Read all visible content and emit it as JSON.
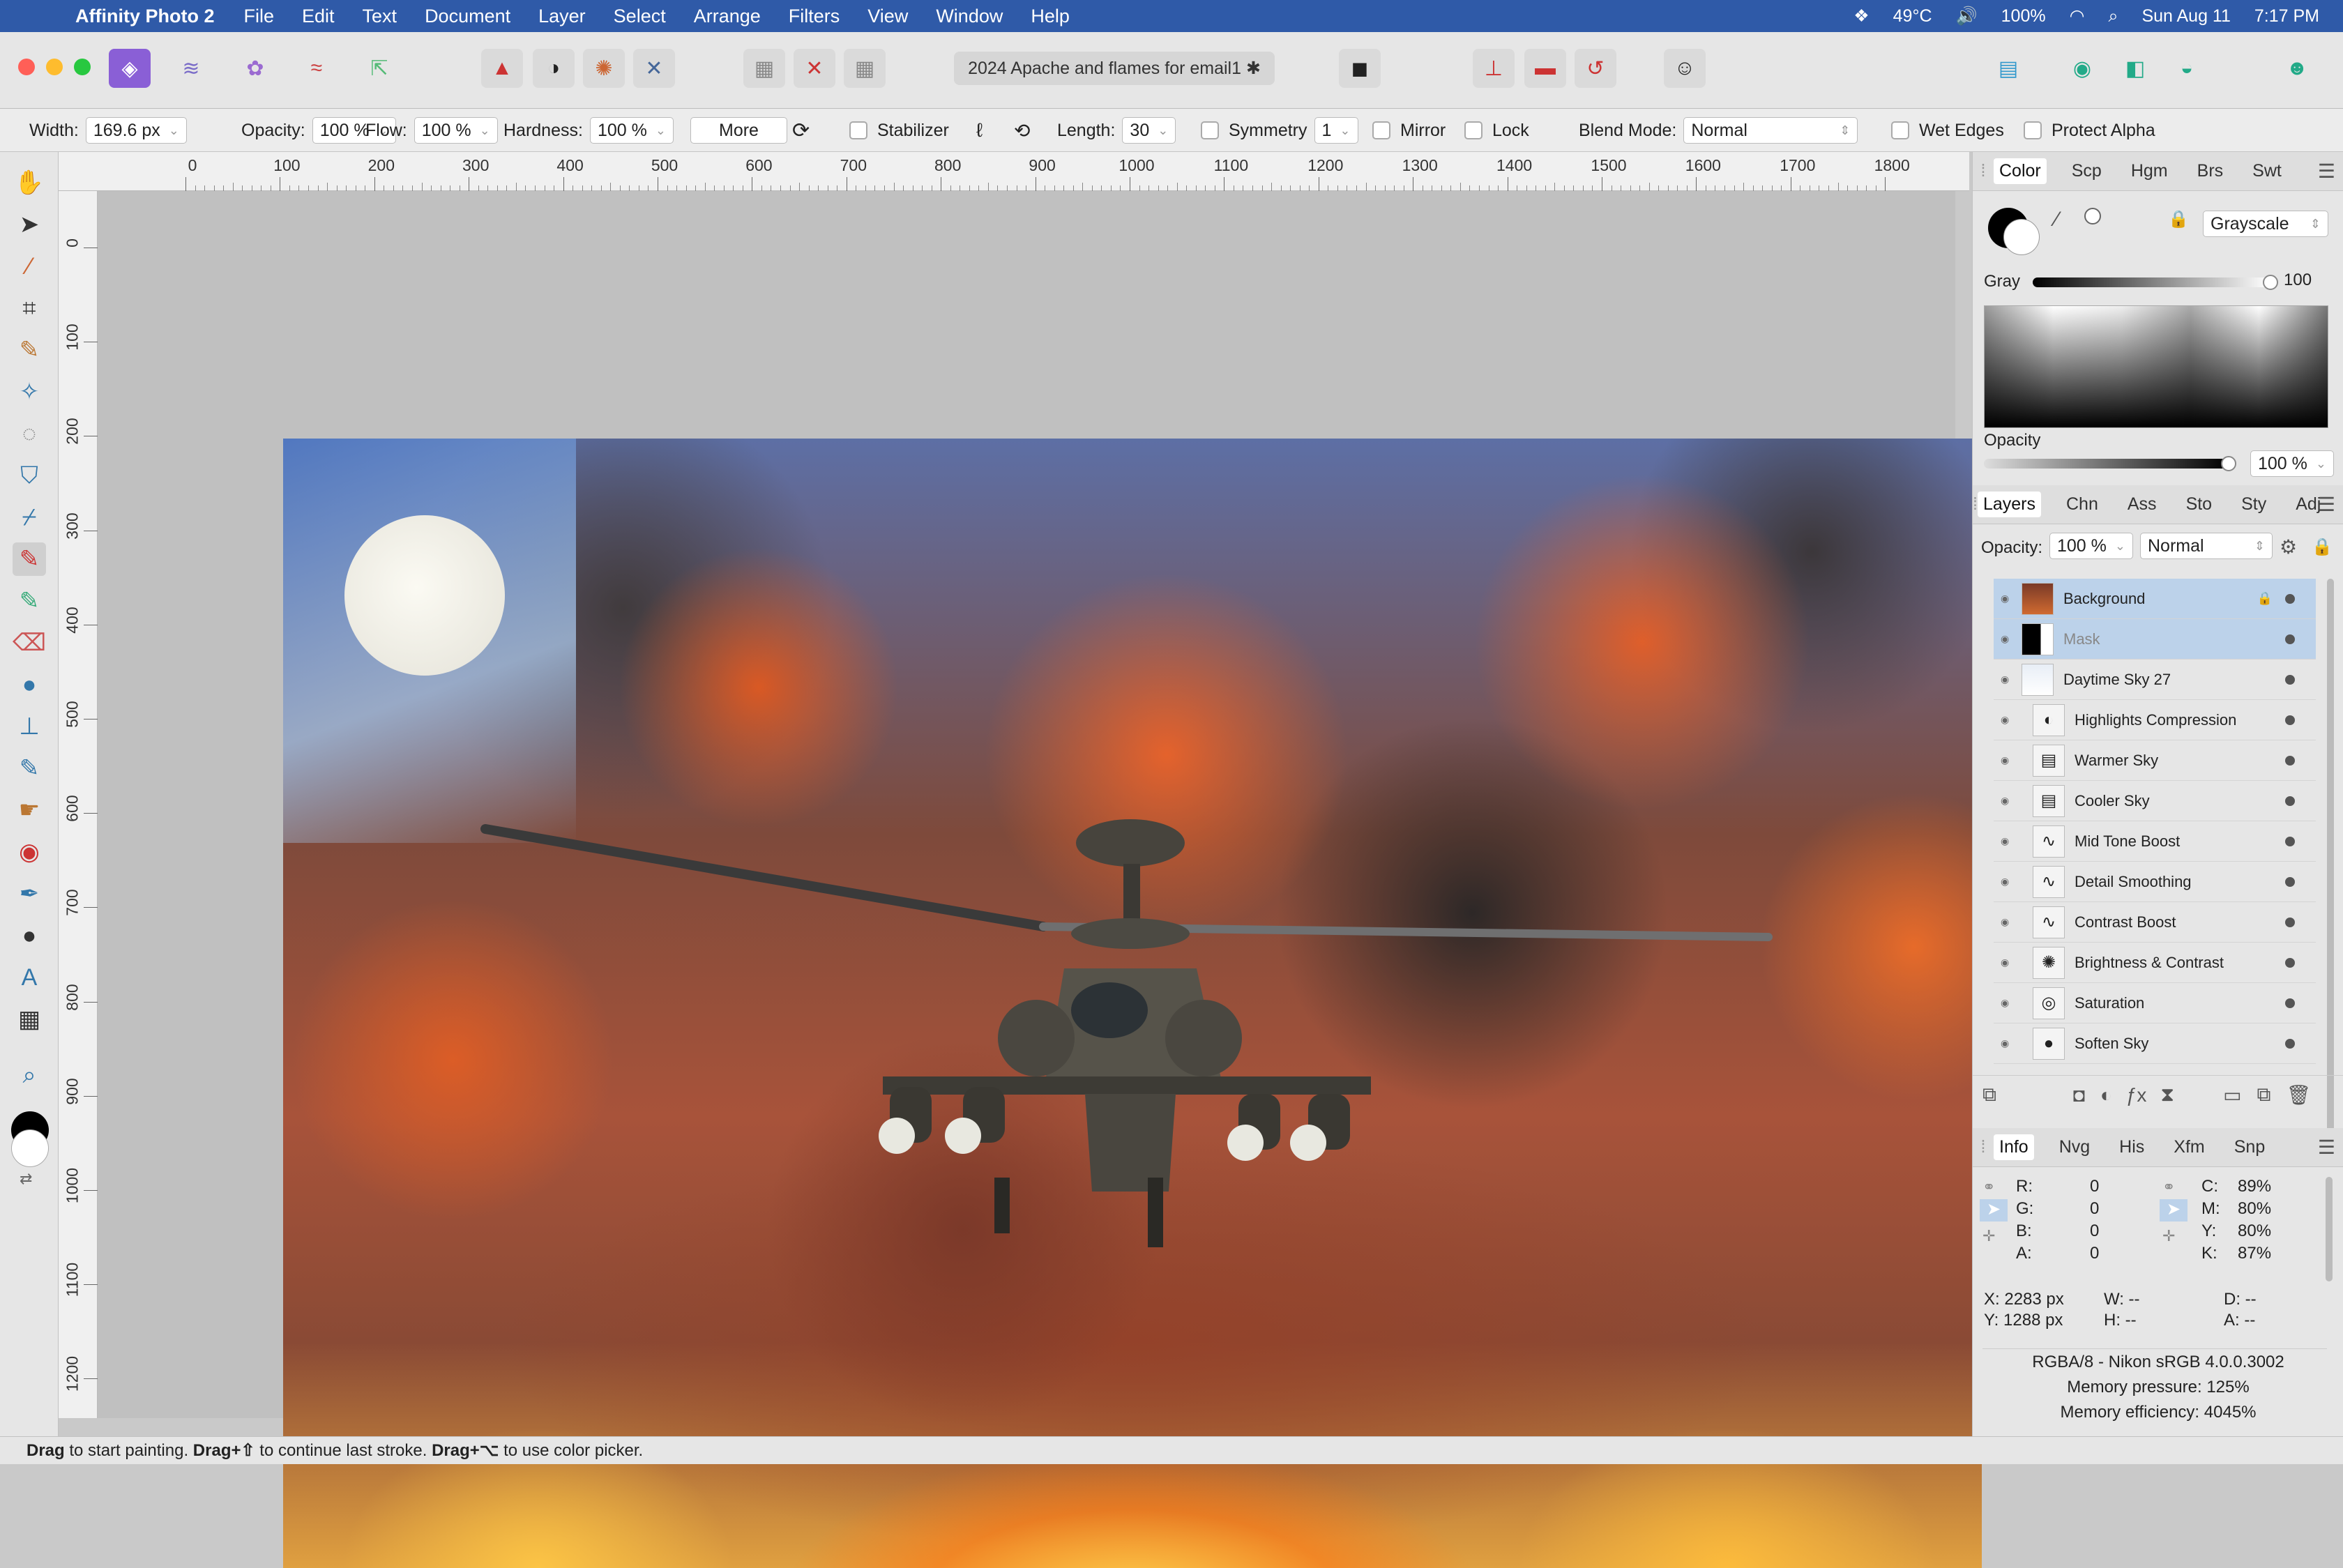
{
  "menubar": {
    "app": "Affinity Photo 2",
    "items": [
      "File",
      "Edit",
      "Text",
      "Document",
      "Layer",
      "Select",
      "Arrange",
      "Filters",
      "View",
      "Window",
      "Help"
    ],
    "status": {
      "temp": "49°C",
      "battery": "100%",
      "date": "Sun Aug 11",
      "time": "7:17 PM"
    }
  },
  "document": {
    "title": "2024 Apache and flames for email1 ✱"
  },
  "context": {
    "width_label": "Width:",
    "width_value": "169.6 px",
    "opacity_label": "Opacity:",
    "opacity_value": "100 %",
    "flow_label": "Flow:",
    "flow_value": "100 %",
    "hardness_label": "Hardness:",
    "hardness_value": "100 %",
    "more_label": "More",
    "stabilizer_label": "Stabilizer",
    "length_label": "Length:",
    "length_value": "30",
    "symmetry_label": "Symmetry",
    "symmetry_value": "1",
    "mirror_label": "Mirror",
    "lock_label": "Lock",
    "blend_label": "Blend Mode:",
    "blend_value": "Normal",
    "wet_edges_label": "Wet Edges",
    "protect_alpha_label": "Protect Alpha"
  },
  "ruler": {
    "unit": "px",
    "h_ticks": [
      "0",
      "100",
      "200",
      "300",
      "400",
      "500",
      "600",
      "700",
      "800",
      "900",
      "1000",
      "1100",
      "1200",
      "1300",
      "1400",
      "1500",
      "1600",
      "1700",
      "1800"
    ],
    "v_ticks": [
      "0",
      "100",
      "200",
      "300",
      "400",
      "500",
      "600",
      "700",
      "800",
      "900",
      "1000",
      "1100",
      "1200"
    ]
  },
  "color_panel": {
    "tabs": [
      "Color",
      "Scp",
      "Hgm",
      "Brs",
      "Swt"
    ],
    "mode": "Grayscale",
    "gray_label": "Gray",
    "gray_value": "100",
    "opacity_label": "Opacity",
    "opacity_value": "100 %"
  },
  "layers_panel": {
    "tabs": [
      "Layers",
      "Chn",
      "Ass",
      "Sto",
      "Sty",
      "Adj"
    ],
    "opacity_label": "Opacity:",
    "opacity_value": "100 %",
    "blend_value": "Normal",
    "layers": [
      {
        "name": "Background",
        "icon": "image-thumb",
        "indent": 0,
        "selected": true
      },
      {
        "name": "Mask",
        "icon": "mask-thumb",
        "indent": 0,
        "selected": true
      },
      {
        "name": "Daytime Sky 27",
        "icon": "group-thumb",
        "indent": 0,
        "selected": false
      },
      {
        "name": "Highlights Compression",
        "icon": "◐",
        "indent": 1,
        "selected": false
      },
      {
        "name": "Warmer Sky",
        "icon": "▤",
        "indent": 1,
        "selected": false
      },
      {
        "name": "Cooler Sky",
        "icon": "▤",
        "indent": 1,
        "selected": false
      },
      {
        "name": "Mid Tone Boost",
        "icon": "∿",
        "indent": 1,
        "selected": false
      },
      {
        "name": "Detail Smoothing",
        "icon": "∿",
        "indent": 1,
        "selected": false
      },
      {
        "name": "Contrast Boost",
        "icon": "∿",
        "indent": 1,
        "selected": false
      },
      {
        "name": "Brightness & Contrast",
        "icon": "✺",
        "indent": 1,
        "selected": false
      },
      {
        "name": "Saturation",
        "icon": "◎",
        "indent": 1,
        "selected": false
      },
      {
        "name": "Soften Sky",
        "icon": "●",
        "indent": 1,
        "selected": false
      }
    ]
  },
  "info_panel": {
    "tabs": [
      "Info",
      "Nvg",
      "His",
      "Xfm",
      "Snp"
    ],
    "rgba": [
      {
        "k": "R:",
        "v": "0"
      },
      {
        "k": "G:",
        "v": "0"
      },
      {
        "k": "B:",
        "v": "0"
      },
      {
        "k": "A:",
        "v": "0"
      }
    ],
    "cmyk": [
      {
        "k": "C:",
        "v": "89%"
      },
      {
        "k": "M:",
        "v": "80%"
      },
      {
        "k": "Y:",
        "v": "80%"
      },
      {
        "k": "K:",
        "v": "87%"
      }
    ],
    "x": "X: 2283 px",
    "y": "Y: 1288 px",
    "w": "W: --",
    "h": "H: --",
    "d": "D: --",
    "a": "A: --",
    "profile": "RGBA/8 - Nikon sRGB 4.0.0.3002",
    "pressure": "Memory pressure: 125%",
    "efficiency": "Memory efficiency: 4045%"
  },
  "statusbar": {
    "b1": "Drag",
    "t1": " to start painting. ",
    "b2": "Drag+⇧",
    "t2": " to continue last stroke. ",
    "b3": "Drag+⌥",
    "t3": " to use color picker."
  }
}
